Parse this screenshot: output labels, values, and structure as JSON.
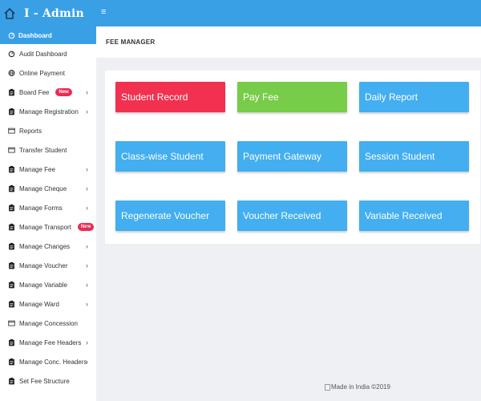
{
  "app": {
    "title": "I - Admin"
  },
  "sidebar": {
    "active": {
      "label": "Dashboard",
      "icon": "dashboard-icon"
    },
    "items": [
      {
        "label": "Audit Dashboard",
        "icon": "dashboard-icon",
        "badge": "",
        "chevron": false
      },
      {
        "label": "Online Payment",
        "icon": "globe-icon",
        "badge": "",
        "chevron": false
      },
      {
        "label": "Board Fee",
        "icon": "clipboard-icon",
        "badge": "New",
        "chevron": true
      },
      {
        "label": "Manage Registration",
        "icon": "clipboard-icon",
        "badge": "",
        "chevron": true
      },
      {
        "label": "Reports",
        "icon": "window-icon",
        "badge": "",
        "chevron": false
      },
      {
        "label": "Transfer Student",
        "icon": "window-icon",
        "badge": "",
        "chevron": false
      },
      {
        "label": "Manage Fee",
        "icon": "clipboard-icon",
        "badge": "",
        "chevron": true
      },
      {
        "label": "Manage Cheque",
        "icon": "clipboard-icon",
        "badge": "",
        "chevron": true
      },
      {
        "label": "Manage Forms",
        "icon": "clipboard-icon",
        "badge": "",
        "chevron": true
      },
      {
        "label": "Manage Transport",
        "icon": "clipboard-icon",
        "badge": "New",
        "chevron": true
      },
      {
        "label": "Manage Changes",
        "icon": "clipboard-icon",
        "badge": "",
        "chevron": true
      },
      {
        "label": "Manage Voucher",
        "icon": "clipboard-icon",
        "badge": "",
        "chevron": true
      },
      {
        "label": "Manage Variable",
        "icon": "clipboard-icon",
        "badge": "",
        "chevron": true
      },
      {
        "label": "Manage Ward",
        "icon": "clipboard-icon",
        "badge": "",
        "chevron": true
      },
      {
        "label": "Manage Concession",
        "icon": "window-icon",
        "badge": "",
        "chevron": false
      },
      {
        "label": "Manage Fee Headers",
        "icon": "clipboard-icon",
        "badge": "",
        "chevron": true
      },
      {
        "label": "Manage Conc. Headers",
        "icon": "clipboard-icon",
        "badge": "",
        "chevron": true
      },
      {
        "label": "Set Fee Structure",
        "icon": "clipboard-icon",
        "badge": "",
        "chevron": false
      }
    ]
  },
  "header": {
    "page_title": "FEE MANAGER"
  },
  "tiles": [
    {
      "label": "Student Record",
      "color": "#f2304f"
    },
    {
      "label": "Pay Fee",
      "color": "#77cc49"
    },
    {
      "label": "Daily Report",
      "color": "#43aef0"
    },
    {
      "label": "Class-wise Student",
      "color": "#43aef0"
    },
    {
      "label": "Payment Gateway",
      "color": "#43aef0"
    },
    {
      "label": "Session Student",
      "color": "#43aef0"
    },
    {
      "label": "Regenerate Voucher",
      "color": "#43aef0"
    },
    {
      "label": "Voucher Received",
      "color": "#43aef0"
    },
    {
      "label": "Variable Received",
      "color": "#43aef0"
    }
  ],
  "footer": {
    "text": "Made in India ©2019"
  },
  "colors": {
    "accent": "#3aa0e6",
    "badge": "#ee2a52"
  }
}
